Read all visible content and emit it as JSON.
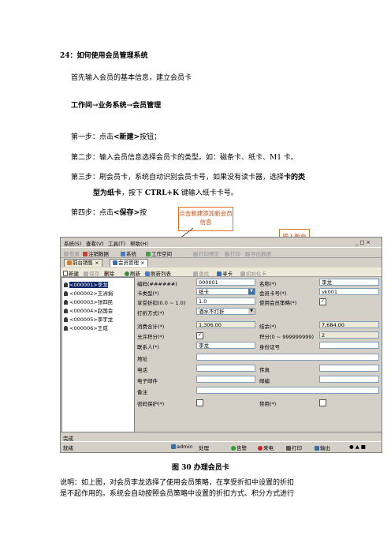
{
  "heading": "24：如何使用会员管理系统",
  "intro": "首先输入会员的基本信息，建立会员卡",
  "path": "工作间→业务系统→会员管理",
  "steps": {
    "s1a": "第一步：点击",
    "s1b": "<新建>",
    "s1c": "按钮；",
    "s2": "第二步：输入会员信息选择会员卡的类型。如：磁条卡、纸卡、M1 卡。",
    "s3a": "第三步：刷会员卡，系统自动识别会员卡号，如果没有读卡器，选择",
    "s3b": "卡的类",
    "s3c": "型为纸卡",
    "s3d": "，按下 ",
    "s3e": "CTRL+K",
    "s3f": " 键输入纸卡卡号。",
    "s4a": "第四步：点击",
    "s4b": "<保存>",
    "s4c": "按"
  },
  "callouts": {
    "new_member": "点击新建添加新会员信息",
    "input_member": "输入新会员信息"
  },
  "screenshot": {
    "menu": [
      "系统(S)",
      "查看(V)",
      "工具(T)",
      "帮助(H)"
    ],
    "toolbar1": [
      "登录",
      "注销数据",
      "系统",
      "工作空间",
      "打印预览",
      "打印",
      "导出数据"
    ],
    "tabs": [
      "前台销售",
      "会员管理"
    ],
    "toolbar2": [
      "新建",
      "保存",
      "删除",
      "刷新",
      "刷新列表",
      "查找",
      "寻卡",
      "初始化卡"
    ],
    "members": [
      "<000001>李龙",
      "<000002>王洲捐",
      "<000003>张四民",
      "<000004>赵国会",
      "<000005>李宇龙",
      "<000006>王成"
    ],
    "form": {
      "code_label": "编码(######)",
      "code_value": "000001",
      "name_label": "名称(*)",
      "name_value": "李龙",
      "cardtype_label": "卡类型(*)",
      "cardtype_value": "纸卡",
      "cardno_label": "会员卡号(*)",
      "cardno_value": "vk001",
      "discount_label": "享受折扣(0.0 ~ 1.0)",
      "discount_value": "1.0",
      "policy_label": "使用会员策略(*)",
      "mode_label": "打折方式(*)",
      "mode_value": "酒水不打折",
      "consume_label": "消费合计(*)",
      "consume_value": "1,306.00",
      "balance_label": "结余(*)",
      "balance_value": "7,684.00",
      "points_allow_label": "允许积分(*)",
      "points_label": "积分(0 ~ 999999999)",
      "points_value": "2",
      "contact_label": "联系人(*)",
      "contact_value": "李龙",
      "id_label": "身份证号",
      "address_label": "地址",
      "phone_label": "电话",
      "fax_label": "传真",
      "email_label": "电子邮件",
      "zip_label": "邮编",
      "note_label": "备注",
      "pwd_label": "密码保护(*)",
      "disabled_label": "禁用(*)"
    },
    "status1": "完成",
    "status2": [
      "就绪",
      "admin",
      "处理",
      "告警",
      "来电",
      "打印",
      "输出"
    ]
  },
  "caption": "图 30 办理会员卡",
  "para1": "说明：如上图，对会员李龙选择了使用会员策略，在享受折扣中设置的折扣",
  "para2": "是不起作用的。系统会自动按照会员策略中设置的折扣方式、积分方式进行"
}
